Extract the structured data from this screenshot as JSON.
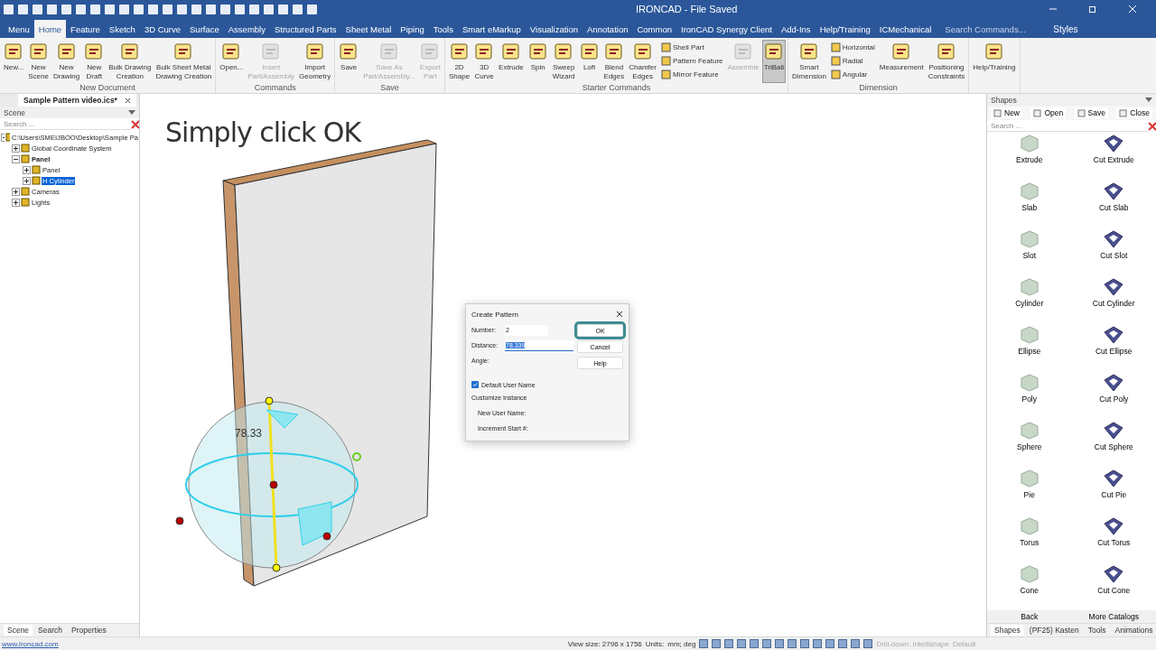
{
  "window": {
    "title": "IRONCAD - File Saved"
  },
  "menu_tabs": [
    {
      "label": "Menu",
      "selected": false
    },
    {
      "label": "Home",
      "selected": true
    },
    {
      "label": "Feature",
      "selected": false
    },
    {
      "label": "Sketch",
      "selected": false
    },
    {
      "label": "3D Curve",
      "selected": false
    },
    {
      "label": "Surface",
      "selected": false
    },
    {
      "label": "Assembly",
      "selected": false
    },
    {
      "label": "Structured Parts",
      "selected": false
    },
    {
      "label": "Sheet Metal",
      "selected": false
    },
    {
      "label": "Piping",
      "selected": false
    },
    {
      "label": "Tools",
      "selected": false
    },
    {
      "label": "Smart eMarkup",
      "selected": false
    },
    {
      "label": "Visualization",
      "selected": false
    },
    {
      "label": "Annotation",
      "selected": false
    },
    {
      "label": "Common",
      "selected": false
    },
    {
      "label": "IronCAD Synergy Client",
      "selected": false
    },
    {
      "label": "Add-Ins",
      "selected": false
    },
    {
      "label": "Help/Training",
      "selected": false
    },
    {
      "label": "ICMechanical",
      "selected": false
    }
  ],
  "command_search": {
    "placeholder": "Search Commands..."
  },
  "styles_menu": "Styles",
  "ribbon": [
    {
      "title": "New Document",
      "items": [
        {
          "kind": "large",
          "label": "New...",
          "disabled": false,
          "selected": false
        },
        {
          "kind": "large",
          "label": "New\nScene",
          "disabled": false,
          "selected": false
        },
        {
          "kind": "large",
          "label": "New\nDrawing",
          "disabled": false,
          "selected": false
        },
        {
          "kind": "large",
          "label": "New\nDraft",
          "disabled": false,
          "selected": false
        },
        {
          "kind": "large",
          "label": "Bulk Drawing\nCreation",
          "disabled": false,
          "selected": false
        },
        {
          "kind": "large",
          "label": "Bulk Sheet Metal\nDrawing Creation",
          "disabled": false,
          "selected": false
        }
      ]
    },
    {
      "title": "Commands",
      "items": [
        {
          "kind": "large",
          "label": "Open...",
          "disabled": false,
          "selected": false
        },
        {
          "kind": "large",
          "label": "Insert\nPart/Assembly",
          "disabled": true,
          "selected": false
        },
        {
          "kind": "large",
          "label": "Import\nGeometry",
          "disabled": false,
          "selected": false
        }
      ]
    },
    {
      "title": "Save",
      "items": [
        {
          "kind": "large",
          "label": "Save",
          "disabled": false,
          "selected": false
        },
        {
          "kind": "large",
          "label": "Save As\nPart/Assembly...",
          "disabled": true,
          "selected": false
        },
        {
          "kind": "large",
          "label": "Export\nPart",
          "disabled": true,
          "selected": false
        }
      ]
    },
    {
      "title": "Starter Commands",
      "items": [
        {
          "kind": "large",
          "label": "2D\nShape",
          "disabled": false,
          "selected": false
        },
        {
          "kind": "large",
          "label": "3D\nCurve",
          "disabled": false,
          "selected": false
        },
        {
          "kind": "large",
          "label": "Extrude",
          "disabled": false,
          "selected": false
        },
        {
          "kind": "large",
          "label": "Spin",
          "disabled": false,
          "selected": false
        },
        {
          "kind": "large",
          "label": "Sweep\nWizard",
          "disabled": false,
          "selected": false
        },
        {
          "kind": "large",
          "label": "Loft",
          "disabled": false,
          "selected": false
        },
        {
          "kind": "large",
          "label": "Blend\nEdges",
          "disabled": false,
          "selected": false
        },
        {
          "kind": "large",
          "label": "Chamfer\nEdges",
          "disabled": false,
          "selected": false
        },
        {
          "kind": "small",
          "label": "Shell Part",
          "disabled": false
        },
        {
          "kind": "small",
          "label": "Pattern Feature",
          "disabled": false
        },
        {
          "kind": "small",
          "label": "Mirror Feature",
          "disabled": false
        },
        {
          "kind": "large",
          "label": "Assemble",
          "disabled": true,
          "selected": false
        },
        {
          "kind": "large",
          "label": "TriBall",
          "disabled": false,
          "selected": true
        }
      ]
    },
    {
      "title": "Dimension",
      "items": [
        {
          "kind": "large",
          "label": "Smart\nDimension",
          "disabled": false,
          "selected": false
        },
        {
          "kind": "small",
          "label": "Horizontal",
          "disabled": false
        },
        {
          "kind": "small",
          "label": "Radial",
          "disabled": false
        },
        {
          "kind": "small",
          "label": "Angular",
          "disabled": false
        },
        {
          "kind": "large",
          "label": "Measurement",
          "disabled": false,
          "selected": false
        },
        {
          "kind": "large",
          "label": "Positioning\nConstraints",
          "disabled": false,
          "selected": false
        }
      ]
    },
    {
      "items": [
        {
          "kind": "large",
          "label": "Help/Training",
          "disabled": false,
          "selected": false
        }
      ]
    }
  ],
  "document_tab": {
    "title": "Sample Pattern video.ics*"
  },
  "scene_panel": {
    "title": "Scene",
    "search": {
      "placeholder": "Search ..."
    },
    "tree": [
      {
        "label": "C:\\Users\\SMEIJBOO\\Desktop\\Sample Pa",
        "bold": false,
        "selected": false,
        "children": [
          {
            "label": "Global Coordinate System",
            "bold": false,
            "selected": false
          },
          {
            "label": "Panel",
            "bold": true,
            "selected": false,
            "children": [
              {
                "label": "Panel",
                "bold": false,
                "selected": false
              },
              {
                "label": "H Cylinder",
                "bold": false,
                "selected": true
              }
            ]
          },
          {
            "label": "Cameras",
            "bold": false,
            "selected": false
          },
          {
            "label": "Lights",
            "bold": false,
            "selected": false
          }
        ]
      }
    ],
    "tabs": [
      {
        "label": "Scene",
        "selected": true
      },
      {
        "label": "Search",
        "selected": false
      },
      {
        "label": "Properties",
        "selected": false
      }
    ]
  },
  "viewport": {
    "caption": "Simply click OK",
    "dimension_label": "78.33"
  },
  "dialog": {
    "title": "Create Pattern",
    "fields": [
      {
        "label": "Number:",
        "value": "2"
      },
      {
        "label": "Distance:",
        "value": "78.339"
      },
      {
        "label": "Angle:"
      }
    ],
    "buttons": [
      {
        "label": "OK",
        "selected": true
      },
      {
        "label": "Cancel",
        "selected": false
      },
      {
        "label": "Help",
        "selected": false
      }
    ],
    "default_user_name": {
      "label": "Default User Name",
      "checked": true
    },
    "section": "Customize Instance",
    "extra_labels": [
      "New User Name:",
      "Increment Start #:"
    ]
  },
  "shapes_panel": {
    "title": "Shapes",
    "toolbar": [
      "New",
      "Open",
      "Save",
      "Close"
    ],
    "search": {
      "placeholder": "Search ..."
    },
    "items": [
      {
        "label": "Extrude",
        "kind": "solid"
      },
      {
        "label": "Cut Extrude",
        "kind": "cut"
      },
      {
        "label": "Slab",
        "kind": "solid"
      },
      {
        "label": "Cut Slab",
        "kind": "cut"
      },
      {
        "label": "Slot",
        "kind": "solid"
      },
      {
        "label": "Cut Slot",
        "kind": "cut"
      },
      {
        "label": "Cylinder",
        "kind": "solid"
      },
      {
        "label": "Cut Cylinder",
        "kind": "cut"
      },
      {
        "label": "Ellipse",
        "kind": "solid"
      },
      {
        "label": "Cut Ellipse",
        "kind": "cut"
      },
      {
        "label": "Poly",
        "kind": "solid"
      },
      {
        "label": "Cut Poly",
        "kind": "cut"
      },
      {
        "label": "Sphere",
        "kind": "solid"
      },
      {
        "label": "Cut Sphere",
        "kind": "cut"
      },
      {
        "label": "Pie",
        "kind": "solid"
      },
      {
        "label": "Cut Pie",
        "kind": "cut"
      },
      {
        "label": "Torus",
        "kind": "solid"
      },
      {
        "label": "Cut Torus",
        "kind": "cut"
      },
      {
        "label": "Cone",
        "kind": "solid"
      },
      {
        "label": "Cut Cone",
        "kind": "cut"
      }
    ],
    "nav": [
      "Back",
      "More Catalogs"
    ],
    "tabs": [
      {
        "label": "Shapes",
        "selected": true
      },
      {
        "label": "(PF25) Kasten",
        "selected": false
      },
      {
        "label": "Tools",
        "selected": false
      },
      {
        "label": "Animations",
        "selected": false
      }
    ]
  },
  "status_bar": {
    "link": "www.ironcad.com",
    "view_size": "View size: 2796 x 1756",
    "units_label": "Units:",
    "units": "mm; deg",
    "drill_down": "Drill-down: Intellishape",
    "style": "Default"
  }
}
